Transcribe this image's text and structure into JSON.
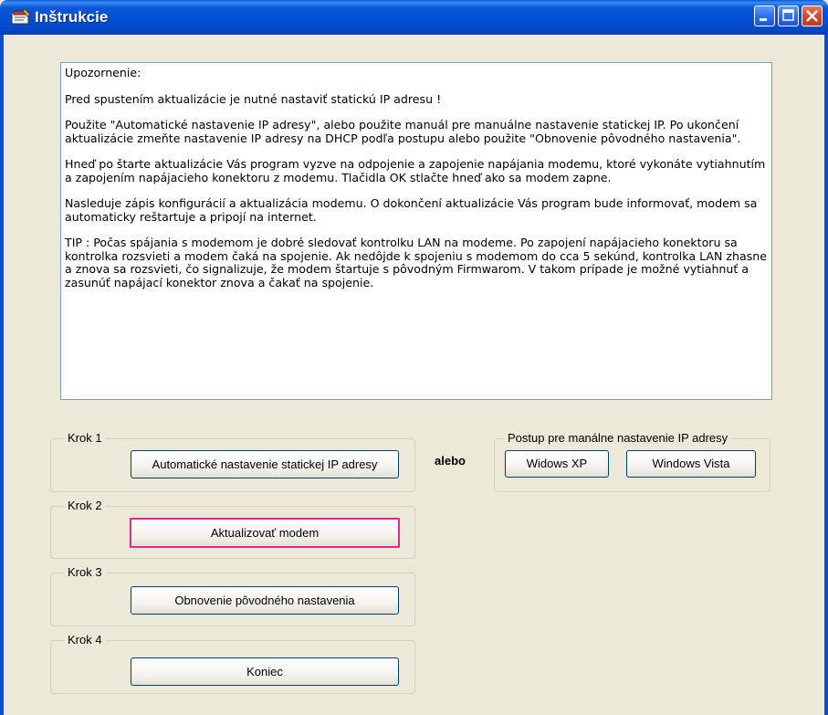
{
  "window": {
    "title": "Inštrukcie",
    "icon": "instructions-app-icon"
  },
  "instructions": {
    "paragraphs": [
      "Upozornenie:",
      "Pred spustením aktualizácie je nutné nastaviť statickú IP adresu !",
      "Použite \"Automatické nastavenie IP adresy\", alebo použite manuál pre manuálne nastavenie statickej IP. Po ukončení aktualizácie zmeňte nastavenie IP adresy na DHCP podľa postupu alebo použite \"Obnovenie pôvodného nastavenia\".",
      "Hneď po štarte aktualizácie Vás program vyzve na odpojenie a zapojenie napájania modemu, ktoré vykonáte vytiahnutím a zapojením napájacieho konektoru z modemu. Tlačidla OK stlačte hneď ako sa modem zapne.",
      "Nasleduje zápis konfigurácií a aktualizácia modemu. O dokončení aktualizácie Vás program bude informovať, modem sa automaticky reštartuje a pripojí na internet.",
      "TIP : Počas spájania s modemom je dobré sledovať kontrolku LAN na modeme. Po zapojení napájacieho konektoru sa kontrolka rozsvieti a modem čaká na spojenie. Ak nedôjde k spojeniu s modemom do cca 5 sekúnd, kontrolka LAN zhasne a znova sa rozsvieti, čo signalizuje, že modem štartuje s pôvodným Firmwarom. V takom prípade je možné vytiahnuť a zasunúť napájací konektor znova a čakať na spojenie."
    ]
  },
  "steps": {
    "step1": {
      "label": "Krok 1",
      "button": "Automatické nastavenie statickej IP adresy"
    },
    "step2": {
      "label": "Krok 2",
      "button": "Aktualizovať modem"
    },
    "step3": {
      "label": "Krok 3",
      "button": "Obnovenie pôvodného nastavenia"
    },
    "step4": {
      "label": "Krok 4",
      "button": "Koniec"
    }
  },
  "or_label": "alebo",
  "manual": {
    "label": "Postup pre manálne nastavenie IP adresy",
    "xp_button": "Widows XP",
    "vista_button": "Windows Vista"
  },
  "colors": {
    "titlebar": "#0450D2",
    "focus_border": "#E0288F",
    "dialog_bg": "#ECE9D8"
  }
}
